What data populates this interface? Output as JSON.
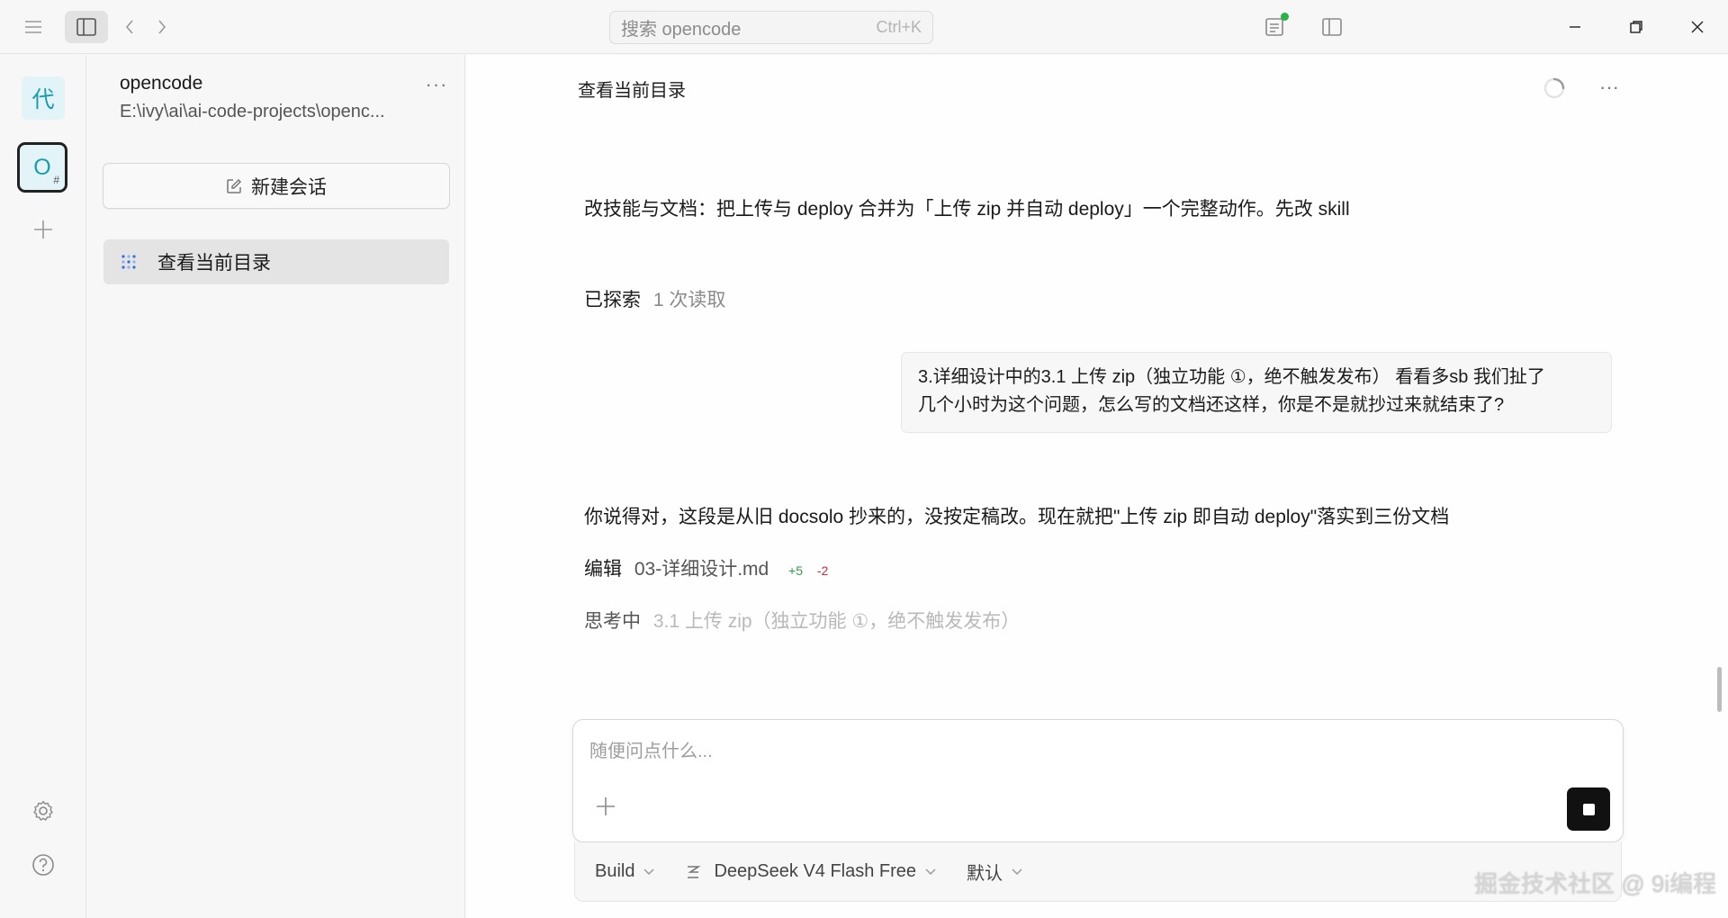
{
  "titlebar": {
    "search_placeholder": "搜索 opencode",
    "search_shortcut": "Ctrl+K"
  },
  "rail": {
    "workspaces": [
      {
        "label": "代"
      },
      {
        "label": "O",
        "sub": "#"
      }
    ]
  },
  "sidebar": {
    "project_name": "opencode",
    "project_path": "E:\\ivy\\ai\\ai-code-projects\\openc...",
    "more": "···",
    "new_session_label": "新建会话",
    "sessions": [
      {
        "title": "查看当前目录"
      }
    ]
  },
  "chat": {
    "title": "查看当前目录",
    "more": "···",
    "assistant_msg_1": "改技能与文档：把上传与 deploy 合并为「上传 zip 并自动 deploy」一个完整动作。先改 skill",
    "explored_label": "已探索",
    "explored_detail": "1 次读取",
    "user_msg_line1": "3.详细设计中的3.1 上传 zip（独立功能 ①，绝不触发发布） 看看多sb 我们扯了",
    "user_msg_line2": "几个小时为这个问题，怎么写的文档还这样，你是不是就抄过来就结束了?",
    "assistant_msg_2": "你说得对，这段是从旧 docsolo 抄来的，没按定稿改。现在就把\"上传 zip 即自动 deploy\"落实到三份文档",
    "edit_label": "编辑",
    "edit_file": "03-详细设计.md",
    "edit_added": "+5",
    "edit_removed": "-2",
    "thinking_label": "思考中",
    "thinking_detail": "3.1 上传 zip（独立功能 ①，绝不触发发布）"
  },
  "composer": {
    "placeholder": "随便问点什么...",
    "agent": "Build",
    "model": "DeepSeek V4 Flash Free",
    "variant": "默认"
  },
  "watermark": "掘金技术社区 @ 9i编程",
  "colors": {
    "accent_teal": "#1b9bb0",
    "status_green": "#28b446",
    "diff_add": "#2f9e44",
    "diff_del": "#d7263d"
  }
}
